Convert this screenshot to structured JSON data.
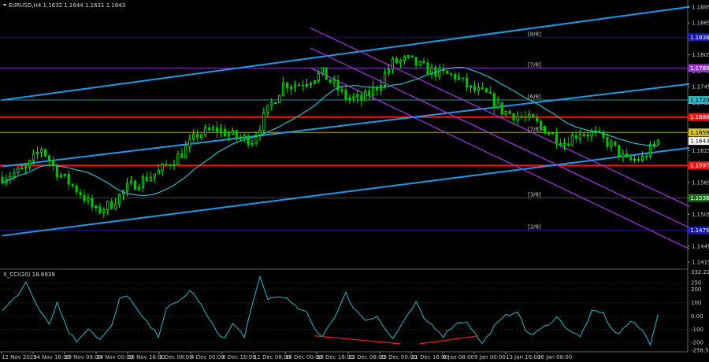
{
  "header": {
    "symbol_line": "EURUSD,H4  1.1632 1.1644 1.1631 1.1643",
    "indicator_line": "X_CCI(20) 18.6939"
  },
  "colors": {
    "background": "#000000",
    "candle_bull": "#00ff00",
    "candle_bear": "#00c000",
    "ma": "#2fb8c8",
    "channel_blue": "#1e9be8",
    "channel_purple": "#9a36d8",
    "red_level": "#ff1010",
    "yellow_level": "#d8c81c",
    "darkblue_level": "#1a1ab8",
    "cci_line": "#2fb8c8",
    "divergence": "#e82020"
  },
  "price_axis": {
    "ticks": [
      "1.1895",
      "1.1865",
      "1.1835",
      "1.1805",
      "1.1775",
      "1.1745",
      "1.1715",
      "1.1685",
      "1.1655",
      "1.1625",
      "1.1595",
      "1.1565",
      "1.1535",
      "1.1505",
      "1.1475",
      "1.1445",
      "1.1415"
    ],
    "range": [
      1.1405,
      1.1905
    ]
  },
  "price_tags": [
    {
      "value": 1.1838,
      "text": "1.1838",
      "color": "#1a1ab8",
      "text_color": "#ffffff"
    },
    {
      "value": 1.178,
      "text": "1.1780",
      "color": "#9a36d8",
      "text_color": "#ffffff"
    },
    {
      "value": 1.172,
      "text": "1.1720",
      "color": "#2fb8c8",
      "text_color": "#000000"
    },
    {
      "value": 1.1688,
      "text": "1.1688",
      "color": "#ff1010",
      "text_color": "#ffffff"
    },
    {
      "value": 1.1659,
      "text": "1.1659",
      "color": "#d8c81c",
      "text_color": "#000000"
    },
    {
      "value": 1.1643,
      "text": "1.1643",
      "color": "#ffffff",
      "text_color": "#000000"
    },
    {
      "value": 1.1597,
      "text": "1.1597",
      "color": "#ff1010",
      "text_color": "#ffffff"
    },
    {
      "value": 1.1536,
      "text": "1.1536",
      "color": "#1e6e1e",
      "text_color": "#ffffff"
    },
    {
      "value": 1.1475,
      "text": "1.1475",
      "color": "#1a1ab8",
      "text_color": "#ffffff"
    }
  ],
  "murrey_labels": [
    {
      "value": 1.1838,
      "text": "[8/8]",
      "color": "#1a1ab8"
    },
    {
      "value": 1.178,
      "text": "[7/8]",
      "color": "#9a36d8"
    },
    {
      "value": 1.172,
      "text": "[6/8]",
      "color": "#2fb8c8"
    },
    {
      "value": 1.1659,
      "text": "[7/8]P",
      "color": "#d8c81c"
    },
    {
      "value": 1.1536,
      "text": "[3/8]",
      "color": "#1e6e1e"
    },
    {
      "value": 1.1475,
      "text": "[2/8]",
      "color": "#1a1ab8"
    }
  ],
  "cci_axis": {
    "ticks": [
      "332.2253",
      "250",
      "200",
      "100",
      "0.00",
      "-100",
      "-200",
      "-258.564"
    ],
    "range": [
      -270,
      340
    ]
  },
  "time_axis": [
    "12 Nov 2025",
    "14 Nov 16:00",
    "19 Nov 08:00",
    "24 Nov 00:00",
    "26 Nov 16:00",
    "1 Dec 08:00",
    "4 Dec 00:00",
    "8 Dec 16:00",
    "11 Dec 08:00",
    "16 Dec 00:00",
    "18 Dec 16:00",
    "23 Dec 08:00",
    "29 Dec 00:00",
    "31 Dec 16:00",
    "6 Jan 08:00",
    "9 Jan 00:00",
    "13 Jan 16:00",
    "16 Jan 08:00"
  ],
  "chart_data": {
    "type": "candlestick",
    "title": "EURUSD,H4",
    "price_keypoints": [
      [
        0,
        1.1575
      ],
      [
        6,
        1.159
      ],
      [
        10,
        1.163
      ],
      [
        14,
        1.1585
      ],
      [
        20,
        1.1545
      ],
      [
        24,
        1.151
      ],
      [
        28,
        1.1525
      ],
      [
        32,
        1.1555
      ],
      [
        36,
        1.157
      ],
      [
        40,
        1.1585
      ],
      [
        46,
        1.162
      ],
      [
        50,
        1.1655
      ],
      [
        55,
        1.1665
      ],
      [
        60,
        1.165
      ],
      [
        64,
        1.1645
      ],
      [
        68,
        1.17
      ],
      [
        72,
        1.175
      ],
      [
        76,
        1.175
      ],
      [
        82,
        1.177
      ],
      [
        86,
        1.174
      ],
      [
        88,
        1.1725
      ],
      [
        92,
        1.172
      ],
      [
        96,
        1.1745
      ],
      [
        100,
        1.179
      ],
      [
        104,
        1.1795
      ],
      [
        108,
        1.178
      ],
      [
        112,
        1.177
      ],
      [
        116,
        1.1765
      ],
      [
        120,
        1.174
      ],
      [
        124,
        1.173
      ],
      [
        128,
        1.17
      ],
      [
        132,
        1.169
      ],
      [
        136,
        1.168
      ],
      [
        140,
        1.166
      ],
      [
        144,
        1.164
      ],
      [
        148,
        1.166
      ],
      [
        152,
        1.1655
      ],
      [
        156,
        1.1635
      ],
      [
        160,
        1.1605
      ],
      [
        164,
        1.161
      ],
      [
        168,
        1.1643
      ]
    ],
    "red_levels": [
      1.1688,
      1.1597
    ],
    "yellow_level": 1.1659,
    "darkblue_levels": [
      1.1838,
      1.1475
    ],
    "purple_level": 1.178,
    "blue_channel": {
      "upper": [
        [
          0,
          1.172
        ],
        [
          176,
          1.1895
        ]
      ],
      "middle": [
        [
          0,
          1.1595
        ],
        [
          176,
          1.175
        ]
      ],
      "lower": [
        [
          0,
          1.1465
        ],
        [
          176,
          1.163
        ]
      ]
    },
    "purple_channel": {
      "upper": [
        [
          79,
          1.1855
        ],
        [
          176,
          1.152
        ]
      ],
      "lower": [
        [
          79,
          1.178
        ],
        [
          176,
          1.144
        ]
      ]
    },
    "cci_keypoints": [
      [
        0,
        50
      ],
      [
        4,
        150
      ],
      [
        6,
        260
      ],
      [
        9,
        80
      ],
      [
        12,
        -60
      ],
      [
        14,
        100
      ],
      [
        17,
        -120
      ],
      [
        19,
        -190
      ],
      [
        22,
        -90
      ],
      [
        25,
        -180
      ],
      [
        28,
        -80
      ],
      [
        30,
        120
      ],
      [
        32,
        160
      ],
      [
        35,
        20
      ],
      [
        37,
        -50
      ],
      [
        40,
        -150
      ],
      [
        42,
        60
      ],
      [
        45,
        100
      ],
      [
        48,
        190
      ],
      [
        50,
        130
      ],
      [
        52,
        20
      ],
      [
        55,
        -120
      ],
      [
        57,
        -170
      ],
      [
        59,
        -60
      ],
      [
        62,
        -150
      ],
      [
        64,
        70
      ],
      [
        66,
        290
      ],
      [
        68,
        130
      ],
      [
        72,
        150
      ],
      [
        75,
        70
      ],
      [
        78,
        20
      ],
      [
        80,
        -100
      ],
      [
        82,
        -150
      ],
      [
        86,
        40
      ],
      [
        88,
        170
      ],
      [
        90,
        60
      ],
      [
        93,
        -30
      ],
      [
        96,
        0
      ],
      [
        98,
        -100
      ],
      [
        100,
        -170
      ],
      [
        103,
        -40
      ],
      [
        106,
        100
      ],
      [
        108,
        -20
      ],
      [
        111,
        -90
      ],
      [
        113,
        -150
      ],
      [
        116,
        -60
      ],
      [
        119,
        -40
      ],
      [
        121,
        -130
      ],
      [
        123,
        -210
      ],
      [
        126,
        -80
      ],
      [
        129,
        0
      ],
      [
        132,
        40
      ],
      [
        134,
        -110
      ],
      [
        136,
        -140
      ],
      [
        139,
        -80
      ],
      [
        142,
        -10
      ],
      [
        145,
        -100
      ],
      [
        148,
        -160
      ],
      [
        151,
        30
      ],
      [
        154,
        20
      ],
      [
        156,
        -100
      ],
      [
        158,
        -130
      ],
      [
        161,
        -40
      ],
      [
        164,
        -110
      ],
      [
        166,
        -210
      ],
      [
        168,
        18.69
      ]
    ],
    "divergence_segments": [
      [
        [
          80,
          -150
        ],
        [
          102,
          -210
        ]
      ],
      [
        [
          107,
          -210
        ],
        [
          122,
          -150
        ]
      ]
    ]
  }
}
